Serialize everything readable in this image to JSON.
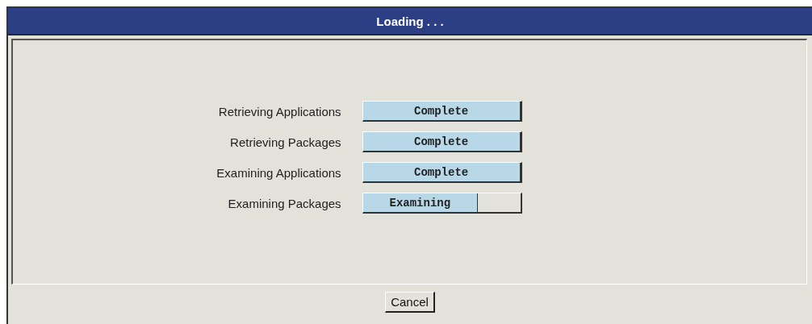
{
  "window": {
    "title": "Loading . . ."
  },
  "tasks": [
    {
      "label": "Retrieving Applications",
      "status": "Complete",
      "level": 1
    },
    {
      "label": "Retrieving Packages",
      "status": "Complete",
      "level": 1
    },
    {
      "label": "Examining Applications",
      "status": "Complete",
      "level": 1
    },
    {
      "label": "Examining Packages",
      "status": "Examining",
      "level": 0.73
    }
  ],
  "buttons": [
    "Cancel"
  ]
}
